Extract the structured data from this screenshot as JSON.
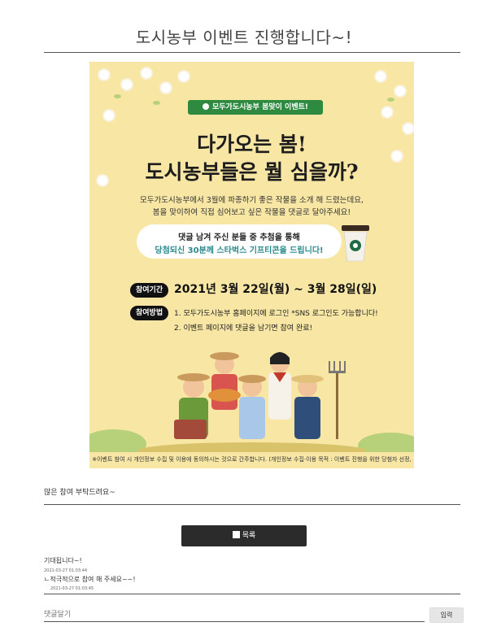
{
  "page": {
    "title": "도시농부 이벤트 진행합니다~!"
  },
  "poster": {
    "banner": "모두가도시농부 봄맞이 이벤트!",
    "headline_1": "다가오는 봄!",
    "headline_2": "도시농부들은 뭘 심을까?",
    "intro_1": "모두가도시농부에서 3월에 파종하기 좋은 작물을 소개 해 드렸는데요,",
    "intro_2": "봄을 맞이하여 직접 심어보고 싶은 작물을 댓글로 달아주세요!",
    "prize_1": "댓글 남겨 주신 분들 중 추첨을 통해",
    "prize_2": "당첨되신 30분께 스타벅스 기프티콘을 드립니다!",
    "period_tag": "참여기간",
    "period": "2021년 3월 22일(월) ~ 3월 28일(일)",
    "method_tag": "참여방법",
    "method_1": "1. 모두가도시농부 홈페이지에 로그인 *SNS 로그인도 가능합니다!",
    "method_2": "2. 이벤트 페이지에 댓글을 남기면 참여 완료!",
    "footnote": "※이벤트 참여 시 개인정보 수집 및 이용에 동의하시는 것으로 간주합니다. (개인정보 수집·이용 목적 : 이벤트 진행을 위한 당첨자 선정, 상품 지급)"
  },
  "comments_lead": "많은 참여 부탁드려요~",
  "list_button": "목록",
  "comments": [
    {
      "text": "기대됩니다~!",
      "date": "2021-03-27 01:03:44"
    },
    {
      "text": "ㄴ적극적으로 참여 해 주세요~~!",
      "date": "2021-03-27 01:03:45"
    }
  ],
  "reply": {
    "placeholder": "댓글달기",
    "submit": "입력"
  },
  "colors": {
    "poster_bg": "#f7e6a4",
    "banner": "#2e8a3e",
    "accent_teal": "#2b8a8d",
    "button_dark": "#2b2b2b"
  }
}
